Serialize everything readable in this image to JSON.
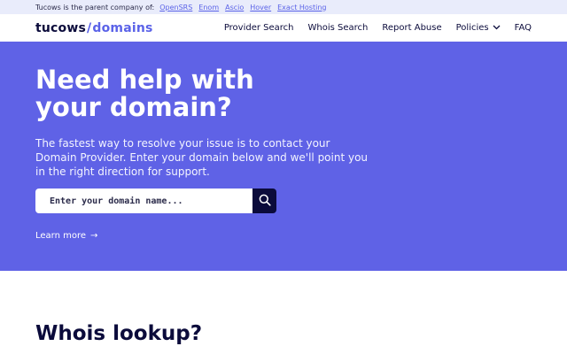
{
  "topbar": {
    "label": "Tucows is the parent company of:",
    "links": [
      "OpenSRS",
      "Enom",
      "Ascio",
      "Hover",
      "Exact Hosting"
    ]
  },
  "nav": {
    "logo_part1": "tucows",
    "logo_slash": "/",
    "logo_part2": "domains",
    "links": {
      "provider_search": "Provider Search",
      "whois_search": "Whois Search",
      "report_abuse": "Report Abuse",
      "policies": "Policies",
      "faq": "FAQ"
    }
  },
  "hero": {
    "title": "Need help with your domain?",
    "description": "The fastest way to resolve your issue is to contact your Domain Provider. Enter your domain below and we'll point you in the right direction for support.",
    "search_placeholder": "Enter your domain name...",
    "learn_more": "Learn more",
    "arrow": "→"
  },
  "section": {
    "title": "Whois lookup?"
  },
  "icons": {
    "search": "search-icon",
    "chevron": "chevron-down-icon",
    "arrow": "arrow-right-icon"
  },
  "colors": {
    "hero_bg": "#5f62e6",
    "navy": "#0b0b3b",
    "topbar_bg": "#e9ecfb",
    "link": "#5b63e8"
  }
}
